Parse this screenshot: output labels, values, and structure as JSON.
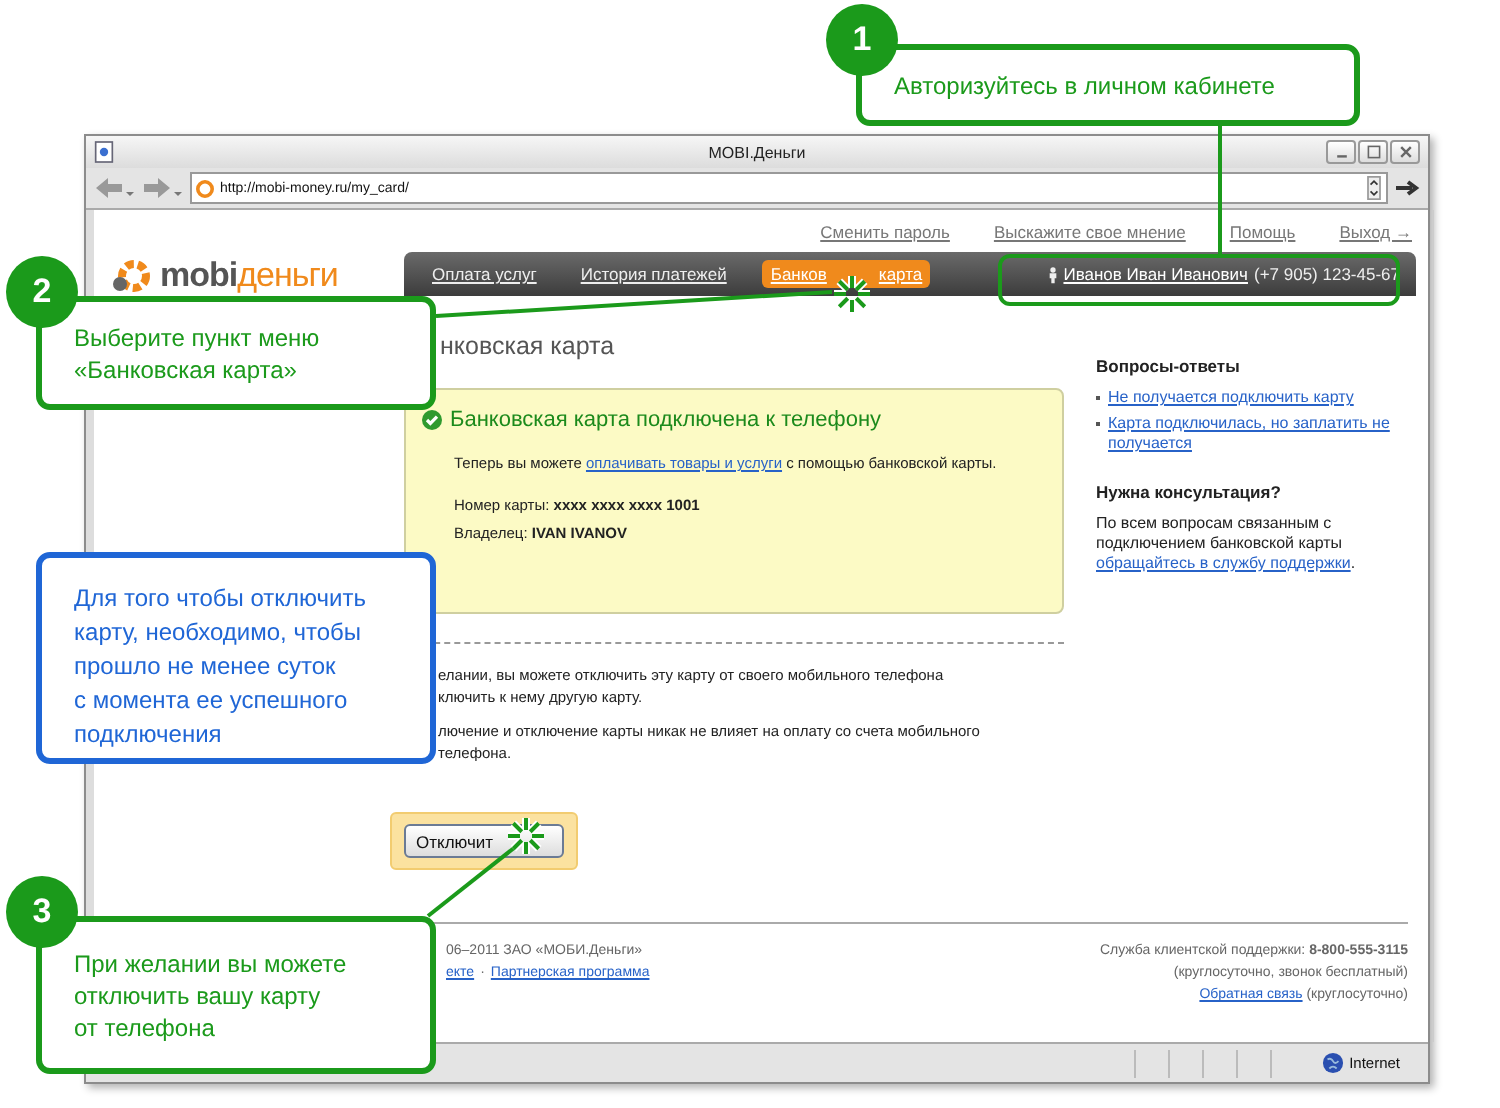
{
  "window": {
    "title": "MOBI.Деньги"
  },
  "address_bar": {
    "url": "http://mobi-money.ru/my_card/"
  },
  "top_links": [
    "Сменить пароль",
    "Выскажите свое мнение",
    "Помощь",
    "Выход →"
  ],
  "logo": {
    "part_1": "mobi",
    "part_2": "деньги"
  },
  "menu": [
    {
      "label_parts": [
        "Оплата услуг"
      ],
      "selected": false
    },
    {
      "label_parts": [
        "История платежей"
      ],
      "selected": false
    },
    {
      "label_parts": [
        "Банков",
        "карта"
      ],
      "selected": true
    }
  ],
  "user": {
    "name": "Иванов Иван Иванович",
    "phone": "(+7 905) 123-45-67"
  },
  "page_heading": "нковская карта",
  "status_box": {
    "title": "Банковская карта подключена к телефону",
    "text_before": "Теперь вы можете ",
    "link": "оплачивать товары и услуги",
    "text_after": " с помощью банковской карты.",
    "card_number_line": "Номер карты: **xxxx xxxx xxxx 1001**",
    "owner_line": "Владелец: **IVAN IVANOV**"
  },
  "notes": [
    [
      "елании, вы можете отключить эту карту от своего мобильного телефона",
      "ключить к нему другую карту."
    ],
    [
      "лючение и отключение карты никак не влияет на оплату со счета мобильного",
      "телефона."
    ]
  ],
  "disconnect_button": {
    "label": "Отключит"
  },
  "sidebar": {
    "faq_title": "Вопросы-ответы",
    "faq_links": [
      "Не получается подключить карту",
      "Карта подключилась, но заплатить не получается"
    ],
    "help_title": "Нужна консультация?",
    "help_text": "По всем вопросам связанным с подключением банковской карты ",
    "help_link": "обращайтесь в службу поддержки",
    "help_end": "."
  },
  "footer": {
    "copyright": "06–2011 ЗАО «МОБИ.Деньги»",
    "links": [
      "екте",
      "Партнерская программа"
    ],
    "separator": "·",
    "support_label": "Служба клиентской поддержки: ",
    "support_phone": "8-800-555-3115",
    "support_note": "(круглосуточно, звонок бесплатный)",
    "feedback_link": "Обратная связь",
    "feedback_note": " (круглосуточно)"
  },
  "status_bar": {
    "zone": "Internet"
  },
  "callouts": [
    {
      "kind": "numbered",
      "number": "1",
      "lines": [
        "Авторизуйтесь в личном кабинете"
      ]
    },
    {
      "kind": "numbered",
      "number": "2",
      "lines": [
        "Выберите пункт меню",
        "«Банковская карта»"
      ]
    },
    {
      "kind": "note",
      "lines": [
        "Для того чтобы отключить",
        "карту, необходимо, чтобы",
        "прошло не менее суток",
        "с момента ее успешного",
        "подключения"
      ]
    },
    {
      "kind": "numbered",
      "number": "3",
      "lines": [
        "При желании вы можете",
        "отключить вашу карту",
        "от телефона"
      ]
    }
  ]
}
